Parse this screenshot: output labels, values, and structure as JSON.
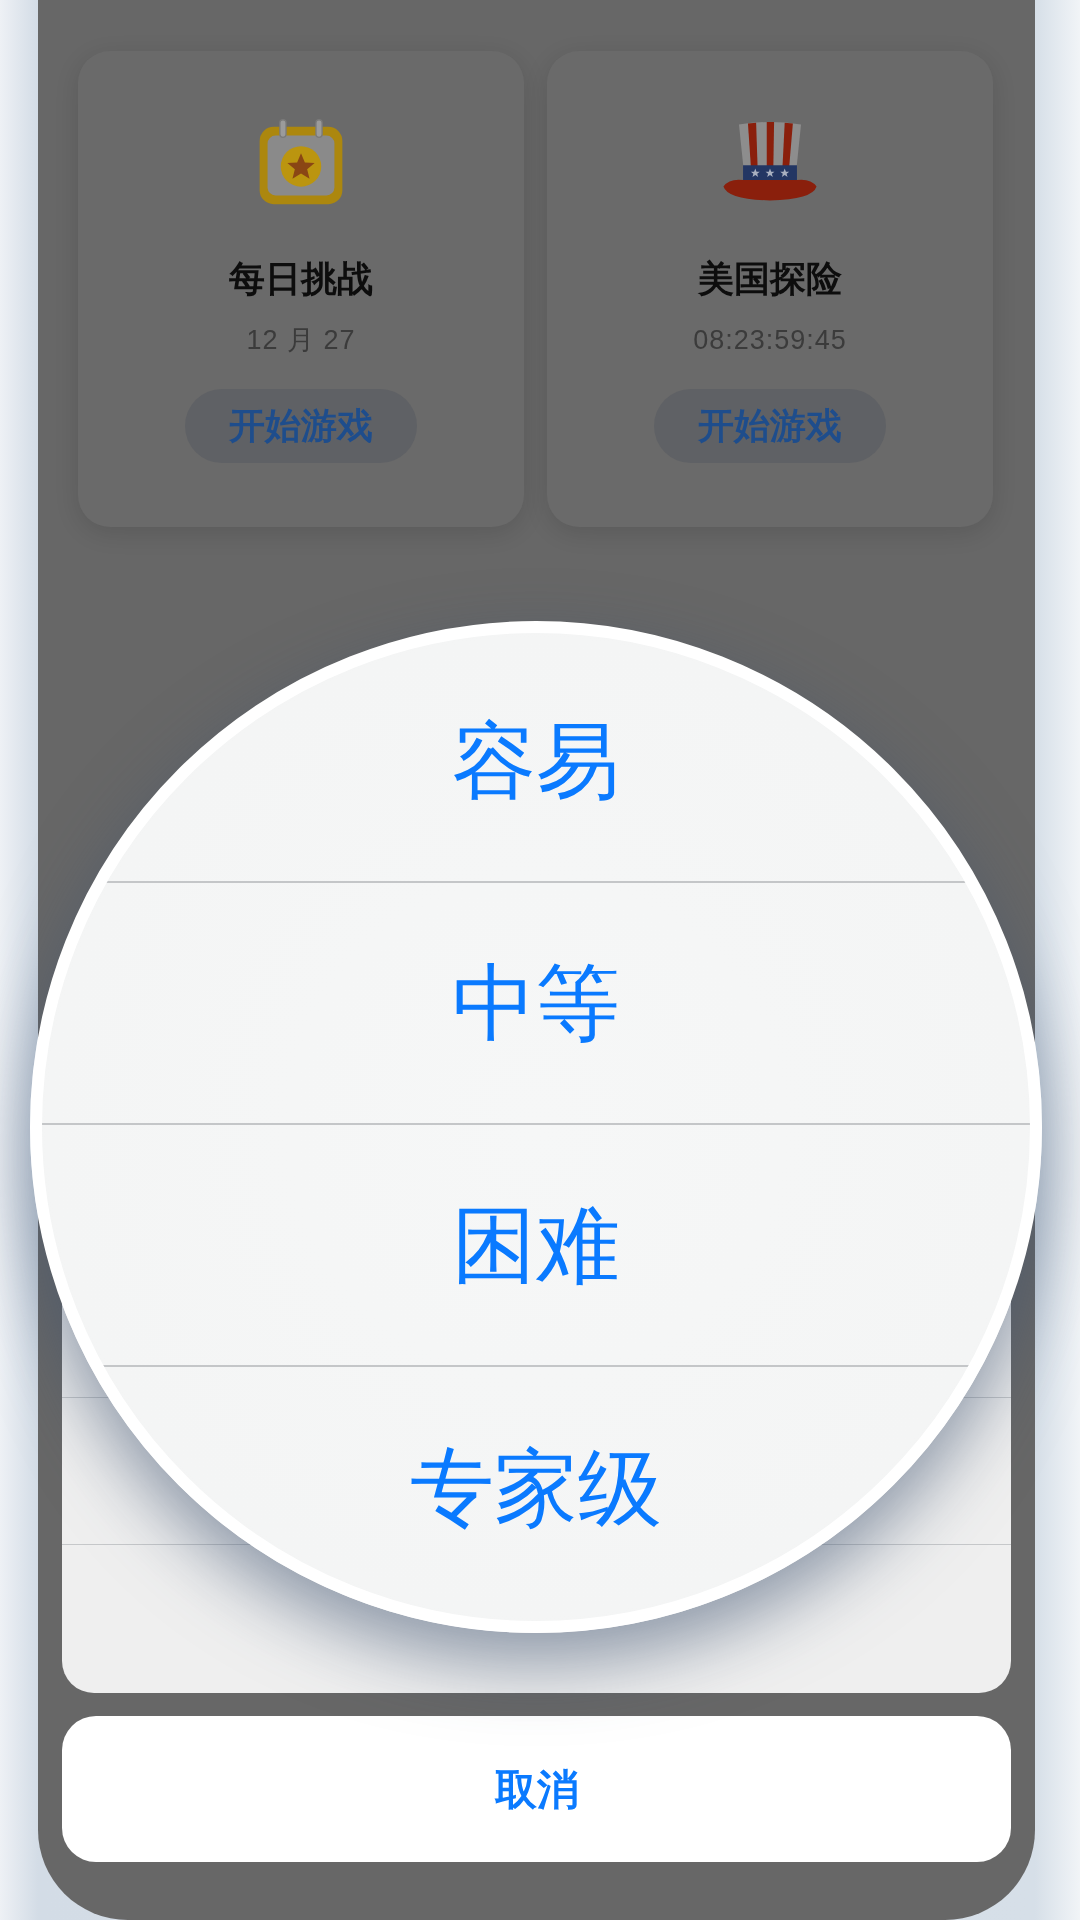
{
  "cards": [
    {
      "kind": "daily",
      "title": "每日挑战",
      "subtitle": "12 月 27",
      "button": "开始游戏"
    },
    {
      "kind": "event",
      "title": "美国探险",
      "subtitle": "08:23:59:45",
      "button": "开始游戏"
    }
  ],
  "magnifier": {
    "options": [
      "容易",
      "中等",
      "困难",
      "专家级"
    ]
  },
  "cancel_button": "取消"
}
